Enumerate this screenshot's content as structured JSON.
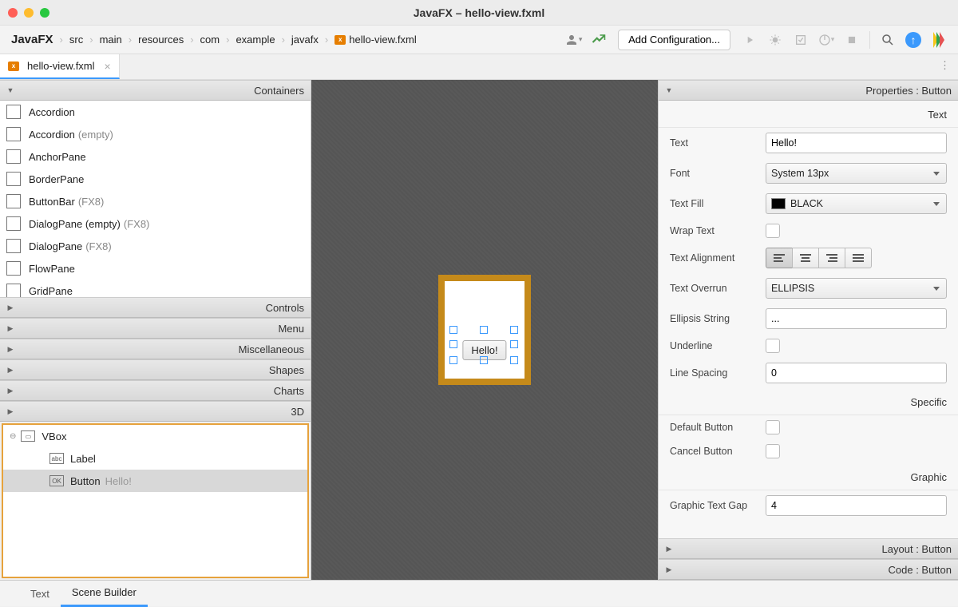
{
  "title": "JavaFX – hello-view.fxml",
  "breadcrumbs": [
    "JavaFX",
    "src",
    "main",
    "resources",
    "com",
    "example",
    "javafx",
    "hello-view.fxml"
  ],
  "toolbar": {
    "add_config": "Add Configuration..."
  },
  "tab": {
    "name": "hello-view.fxml"
  },
  "left": {
    "sections": {
      "containers": "Containers",
      "controls": "Controls",
      "menu": "Menu",
      "misc": "Miscellaneous",
      "shapes": "Shapes",
      "charts": "Charts",
      "three_d": "3D"
    },
    "containers": [
      {
        "label": "Accordion",
        "extra": ""
      },
      {
        "label": "Accordion",
        "extra": "(empty)"
      },
      {
        "label": "AnchorPane",
        "extra": ""
      },
      {
        "label": "BorderPane",
        "extra": ""
      },
      {
        "label": "ButtonBar",
        "extra": "(FX8)"
      },
      {
        "label": "DialogPane (empty)",
        "extra": "(FX8)"
      },
      {
        "label": "DialogPane",
        "extra": "(FX8)"
      },
      {
        "label": "FlowPane",
        "extra": ""
      },
      {
        "label": "GridPane",
        "extra": ""
      }
    ],
    "hierarchy": {
      "root": "VBox",
      "children": [
        {
          "type": "Label",
          "text": ""
        },
        {
          "type": "Button",
          "text": "Hello!"
        }
      ]
    }
  },
  "canvas": {
    "button_text": "Hello!"
  },
  "properties": {
    "header": "Properties : Button",
    "layout_header": "Layout : Button",
    "code_header": "Code : Button",
    "sections": {
      "text": "Text",
      "specific": "Specific",
      "graphic": "Graphic"
    },
    "rows": {
      "text_label": "Text",
      "text_value": "Hello!",
      "font_label": "Font",
      "font_value": "System 13px",
      "textfill_label": "Text Fill",
      "textfill_value": "BLACK",
      "wraptext_label": "Wrap Text",
      "alignment_label": "Text Alignment",
      "overrun_label": "Text Overrun",
      "overrun_value": "ELLIPSIS",
      "ellipsis_label": "Ellipsis String",
      "ellipsis_value": "...",
      "underline_label": "Underline",
      "linespacing_label": "Line Spacing",
      "linespacing_value": "0",
      "defaultbtn_label": "Default Button",
      "cancelbtn_label": "Cancel Button",
      "graphicgap_label": "Graphic Text Gap",
      "graphicgap_value": "4"
    }
  },
  "bottom": {
    "text": "Text",
    "sb": "Scene Builder"
  }
}
